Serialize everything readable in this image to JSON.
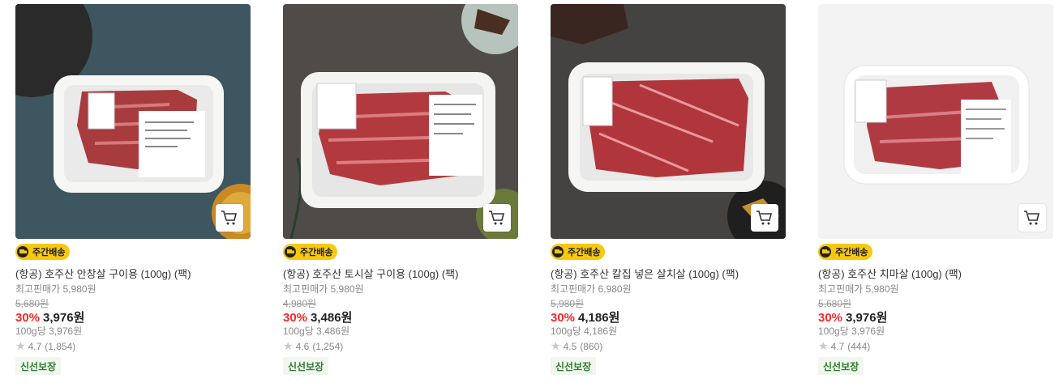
{
  "products": [
    {
      "badge": "주간배송",
      "name": "(항공) 호주산 안창살 구이용 (100g) (팩)",
      "lowest_price": "최고핀매가 5,980원",
      "original_price": "5,680원",
      "discount_rate": "30%",
      "price": "3,976원",
      "unit_price": "100g당 3,976원",
      "rating": "4.7",
      "review_count": "(1,854)",
      "tag": "신선보장"
    },
    {
      "badge": "주간배송",
      "name": "(항공) 호주산 토시살 구이용 (100g) (팩)",
      "lowest_price": "최고핀매가 5,980원",
      "original_price": "4,980원",
      "discount_rate": "30%",
      "price": "3,486원",
      "unit_price": "100g당 3,486원",
      "rating": "4.6",
      "review_count": "(1,254)",
      "tag": "신선보장"
    },
    {
      "badge": "주간배송",
      "name": "(항공) 호주산 칼집 넣은 살치살 (100g) (팩)",
      "lowest_price": "최고핀매가 6,980원",
      "original_price": "5,980원",
      "discount_rate": "30%",
      "price": "4,186원",
      "unit_price": "100g당 4,186원",
      "rating": "4.5",
      "review_count": "(860)",
      "tag": "신선보장"
    },
    {
      "badge": "주간배송",
      "name": "(항공) 호주산 치마살 (100g) (팩)",
      "lowest_price": "최고핀매가 5,980원",
      "original_price": "5,680원",
      "discount_rate": "30%",
      "price": "3,976원",
      "unit_price": "100g당 3,976원",
      "rating": "4.7",
      "review_count": "(444)",
      "tag": "신선보장"
    }
  ],
  "colors": {
    "discount": "#fa2828",
    "badge": "#f7c80f",
    "fresh_tag": "#2f7d32"
  },
  "icons": {
    "cart": "cart-icon",
    "delivery": "truck-icon",
    "rating": "star-icon"
  }
}
